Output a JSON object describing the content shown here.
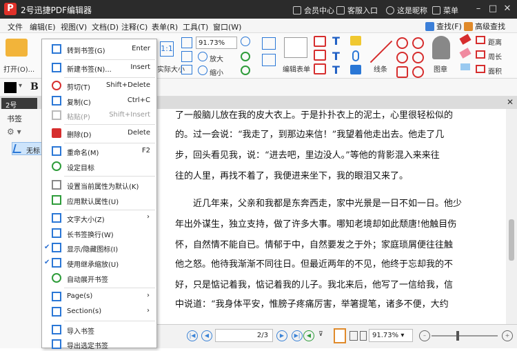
{
  "titlebar": {
    "logo_letter": "P",
    "title": "2号迅捷PDF编辑器",
    "member_center": "会员中心",
    "support": "客服入口",
    "nickname": "这是昵称",
    "menu_label": "菜单"
  },
  "menu": {
    "items": [
      "文件",
      "编辑(E)",
      "视图(V)",
      "文档(D)",
      "注释(C)",
      "表单(R)",
      "工具(T)",
      "窗口(W)"
    ],
    "find": "查找(F)",
    "advanced_find": "高级查找(S)"
  },
  "ribbon": {
    "open_label": "打开(O)...",
    "fit_label": "实际大小",
    "zoom_value": "91.73%",
    "zoom_in": "放大",
    "zoom_out": "缩小",
    "edit_form": "编辑表单",
    "lines": "线条",
    "stamp": "图章",
    "distance": "距离",
    "perimeter": "周长",
    "area": "面积"
  },
  "toolbar2": {
    "bold": "B"
  },
  "doc_tab": {
    "name": "2号",
    "close": "✕"
  },
  "bookmark_panel": {
    "title": "书签",
    "item_label": "无标"
  },
  "context_menu": {
    "items": [
      {
        "label": "转到书签(G)",
        "shortcut": "Enter"
      },
      {
        "label": "新建书签(N)...",
        "shortcut": "Insert"
      },
      {
        "label": "剪切(T)",
        "shortcut": "Shift+Delete"
      },
      {
        "label": "复制(C)",
        "shortcut": "Ctrl+C"
      },
      {
        "label": "粘贴(P)",
        "shortcut": "Shift+Insert"
      },
      {
        "label": "删除(D)",
        "shortcut": "Delete"
      },
      {
        "label": "重命名(M)",
        "shortcut": "F2"
      },
      {
        "label": "设定目标",
        "shortcut": ""
      },
      {
        "label": "设置当前属性为默认(K)",
        "shortcut": ""
      },
      {
        "label": "应用默认属性(U)",
        "shortcut": ""
      },
      {
        "label": "文字大小(Z)",
        "shortcut": "›"
      },
      {
        "label": "长书签换行(W)",
        "shortcut": ""
      },
      {
        "label": "显示/隐藏图标(I)",
        "shortcut": ""
      },
      {
        "label": "使用继承缩放(U)",
        "shortcut": ""
      },
      {
        "label": "自动展开书签",
        "shortcut": ""
      },
      {
        "label": "Page(s)",
        "shortcut": "›"
      },
      {
        "label": "Section(s)",
        "shortcut": "›"
      },
      {
        "label": "导入书签",
        "shortcut": ""
      },
      {
        "label": "导出选定书签",
        "shortcut": ""
      }
    ],
    "check_mark": "✔"
  },
  "document": {
    "lines": [
      "了一般脑儿放在我的皮大衣上。于是扑扑衣上的泥土，心里很轻松似的",
      "的。过一会说：“我走了，到那边来信！”我望着他走出去。他走了几",
      "步，回头看见我，说：“进去吧，里边没人。”等他的背影混入来来往",
      "往的人里，再找不着了，我便进来坐下，我的眼泪又来了。",
      "近几年来，父亲和我都是东奔西走，家中光景是一日不如一日。他少",
      "年出外谋生，独立支持，做了许多大事。哪知老境却如此颓唐!他触目伤",
      "怀，自然情不能自已。情郁于中，自然要发之于外；家庭琐屑便往往触",
      "他之怒。他待我渐渐不同往日。但最近两年的不见，他终于忘却我的不",
      "好，只是惦记着我，惦记着我的儿子。我北来后，他写了一信给我，信",
      "中说道：“我身体平安，惟膀子疼痛厉害，举箸提笔，诸多不便，大约"
    ]
  },
  "pagination": {
    "page": "2/3",
    "zoom": "91.73%"
  },
  "colors": {
    "title_bg": "#2b2b2b",
    "accent": "#2a77d6",
    "annot_red": "#d62d2d"
  }
}
